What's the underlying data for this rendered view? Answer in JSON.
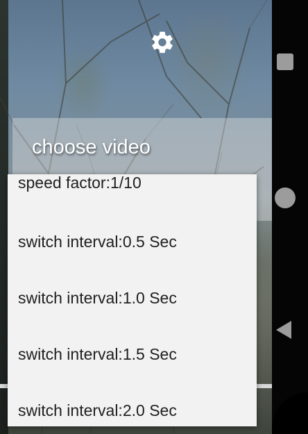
{
  "toolbar": {
    "settings_icon": "gear-icon",
    "choose_video_label": "choose video"
  },
  "menu": {
    "items": [
      {
        "label": "speed factor:1/10"
      },
      {
        "label": "switch interval:0.5 Sec"
      },
      {
        "label": "switch interval:1.0 Sec"
      },
      {
        "label": "switch interval:1.5 Sec"
      },
      {
        "label": "switch interval:2.0 Sec"
      }
    ]
  },
  "navbar": {
    "icons": [
      "recents-icon",
      "home-icon",
      "back-icon"
    ]
  },
  "colors": {
    "menu_background": "#f2f2f2",
    "menu_text": "#1f1f1f",
    "choose_video_text": "#ffffff",
    "navbar_background": "#050505",
    "navbar_icon": "#9c9c9c"
  }
}
